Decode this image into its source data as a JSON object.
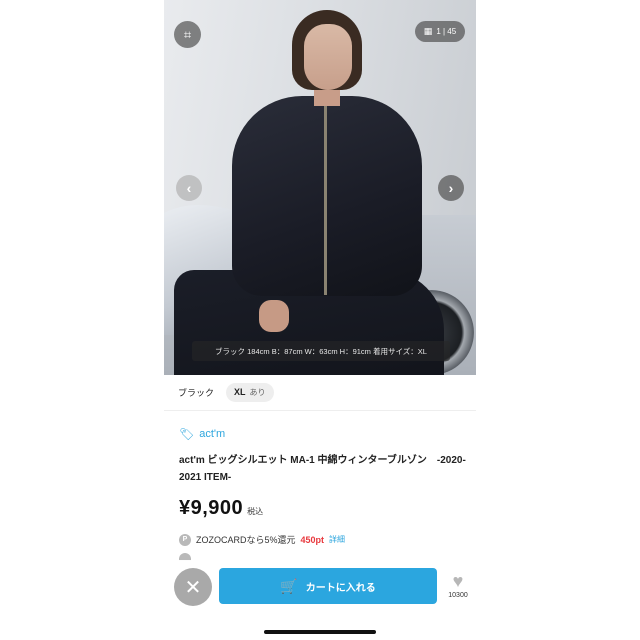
{
  "gallery": {
    "counter": "1 | 45",
    "caption": "ブラック 184cm B：87cm W：63cm H：91cm 着用サイズ：XL"
  },
  "variant": {
    "color": "ブラック",
    "size": "XL",
    "stock": "あり"
  },
  "product": {
    "brand": "act'm",
    "title": "act'm ビッグシルエット MA-1 中綿ウィンターブルゾン　-2020-2021 ITEM-",
    "price": "¥9,900",
    "tax_label": "税込"
  },
  "points": {
    "badge": "P",
    "text": "ZOZOCARDなら5%還元",
    "amount": "450pt",
    "detail_link": "詳細"
  },
  "actions": {
    "cart_label": "カートに入れる",
    "favorite_count": "10300"
  },
  "colors": {
    "accent": "#2ba6df",
    "point_red": "#e8383d"
  },
  "icons": [
    "scan-icon",
    "grid-icon",
    "chevron-left-icon",
    "chevron-right-icon",
    "tag-icon",
    "close-icon",
    "cart-icon",
    "heart-icon"
  ]
}
